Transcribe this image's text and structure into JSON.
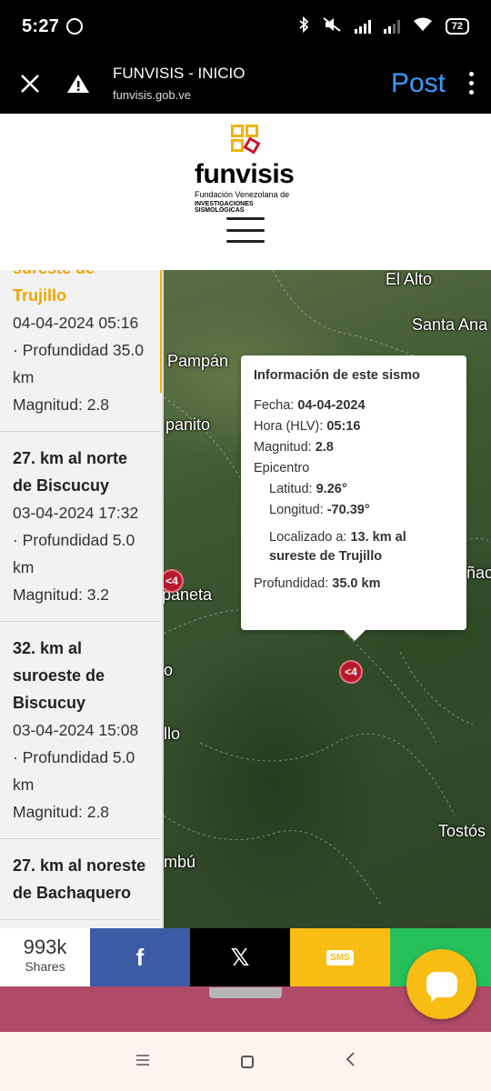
{
  "status": {
    "time": "5:27",
    "battery": "72"
  },
  "toolbar": {
    "title": "FUNVISIS - INICIO",
    "url": "funvisis.gob.ve",
    "post_label": "Post"
  },
  "logo": {
    "word": "funvisis",
    "sub1": "Fundación Venezolana de",
    "sub2": "INVESTIGACIONES SISMOLÓGICAS"
  },
  "quakes": [
    {
      "loc": "sureste de Trujillo",
      "date": "04-04-2024 05:16",
      "depth": "· Profundidad 35.0 km",
      "mag": "Magnitud: 2.8"
    },
    {
      "loc": "27. km al norte de Biscucuy",
      "date": "03-04-2024 17:32",
      "depth": "· Profundidad 5.0 km",
      "mag": "Magnitud: 3.2"
    },
    {
      "loc": "32. km al suroeste de Biscucuy",
      "date": "03-04-2024 15:08",
      "depth": "· Profundidad 5.0 km",
      "mag": "Magnitud: 2.8"
    },
    {
      "loc": "27. km al noreste de Bachaquero",
      "date": "",
      "depth": "",
      "mag": ""
    }
  ],
  "map": {
    "labels": [
      "El Alto",
      "Santa Ana",
      "Pampán",
      "panito",
      "paneta",
      "llo",
      "Tostós",
      "mbú",
      "ñac",
      "o"
    ],
    "marker_label": "<4"
  },
  "popup": {
    "heading": "Información de este sismo",
    "fecha_label": "Fecha:",
    "fecha": "04-04-2024",
    "hora_label": "Hora (HLV):",
    "hora": "05:16",
    "mag_label": "Magnitud:",
    "mag": "2.8",
    "epi_label": "Epicentro",
    "lat_label": "Latitud:",
    "lat": "9.26°",
    "lon_label": "Longitud:",
    "lon": "-70.39°",
    "loc_label": "Localizado a:",
    "loc": "13. km al sureste de Trujillo",
    "prof_label": "Profundidad:",
    "prof": "35.0 km"
  },
  "share": {
    "count": "993k",
    "label": "Shares",
    "fb": "f",
    "x": "𝕏",
    "sms": "SMS"
  },
  "colors": {
    "accent": "#f0b400",
    "facebook": "#3b5ba5",
    "sms": "#f8bd14",
    "whatsapp": "#25c05a",
    "marker": "#b8192d"
  }
}
